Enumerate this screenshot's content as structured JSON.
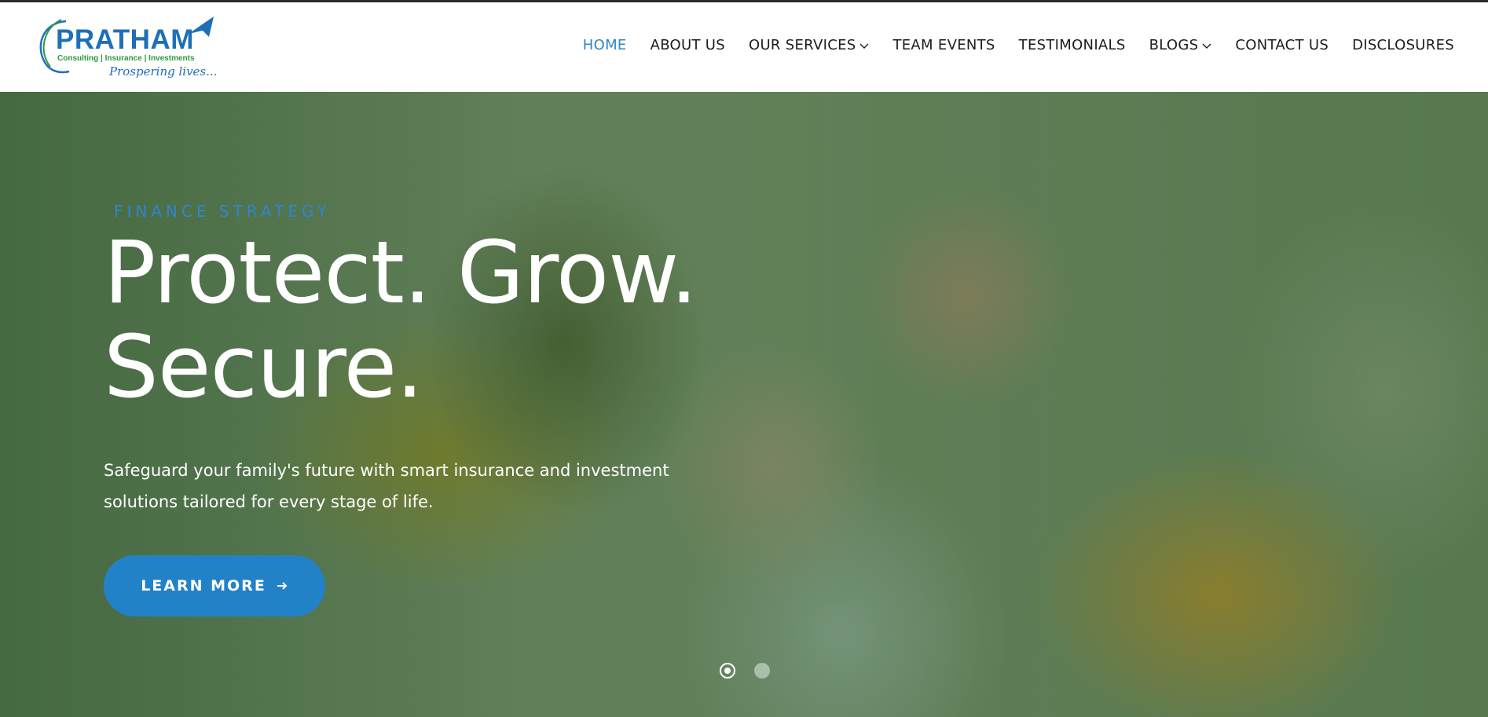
{
  "logo": {
    "name": "PRATHAM",
    "tagline": "Consulting | Insurance | Investments",
    "slogan": "Prospering lives..."
  },
  "nav": {
    "items": [
      {
        "label": "HOME",
        "active": true
      },
      {
        "label": "ABOUT US"
      },
      {
        "label": "OUR SERVICES",
        "dropdown": true
      },
      {
        "label": "TEAM EVENTS"
      },
      {
        "label": "TESTIMONIALS"
      },
      {
        "label": "BLOGS",
        "dropdown": true
      },
      {
        "label": "CONTACT US"
      },
      {
        "label": "DISCLOSURES"
      }
    ]
  },
  "hero": {
    "eyebrow": "FINANCE STRATEGY",
    "headline_line1": "Protect. Grow.",
    "headline_line2": "Secure.",
    "subtitle": "Safeguard your family's future with smart insurance and investment solutions tailored for every stage of life.",
    "cta_label": "LEARN MORE",
    "slides_total": 2,
    "current_slide": 1
  },
  "colors": {
    "accent": "#2282c8",
    "nav_active": "#2c86cc",
    "logo_blue": "#1f6fb8",
    "logo_green": "#2f9a3f"
  }
}
